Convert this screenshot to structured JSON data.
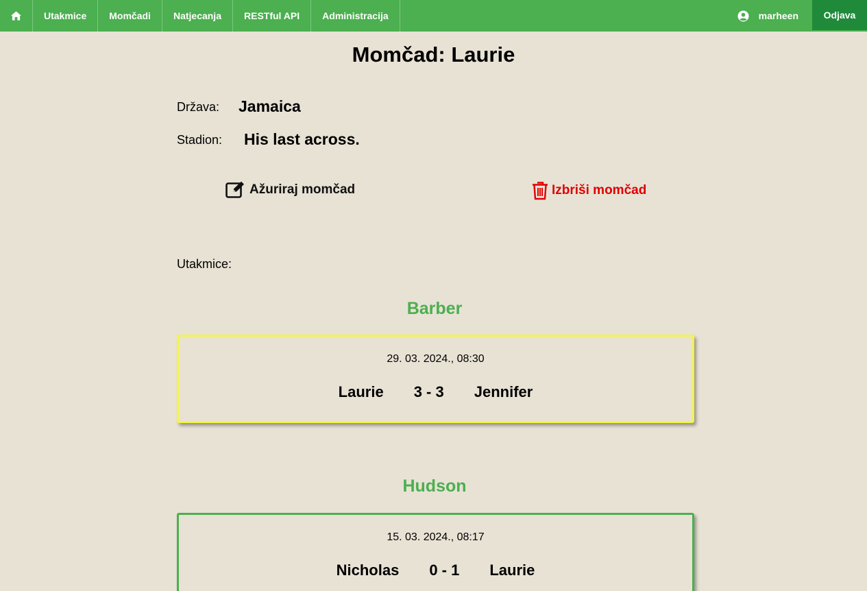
{
  "nav": {
    "items": [
      "Utakmice",
      "Momčadi",
      "Natjecanja",
      "RESTful API",
      "Administracija"
    ],
    "username": "marheen",
    "logout": "Odjava"
  },
  "page": {
    "title": "Momčad: Laurie",
    "country_label": "Država:",
    "country_value": "Jamaica",
    "stadium_label": "Stadion:",
    "stadium_value": "His last across.",
    "edit_label": "Ažuriraj momčad",
    "delete_label": "Izbriši momčad",
    "matches_label": "Utakmice:"
  },
  "matches": [
    {
      "competition": "Barber",
      "datetime": "29. 03. 2024., 08:30",
      "home": "Laurie",
      "score": "3 - 3",
      "away": "Jennifer",
      "border_color": "#f5f542"
    },
    {
      "competition": "Hudson",
      "datetime": "15. 03. 2024., 08:17",
      "home": "Nicholas",
      "score": "0 - 1",
      "away": "Laurie",
      "border_color": "#4caf50"
    }
  ],
  "colors": {
    "nav_bg": "#4caf50",
    "logout_bg": "#1e8a3a",
    "page_bg": "#e8e2d5",
    "delete": "#e00000",
    "competition": "#4caf50"
  }
}
